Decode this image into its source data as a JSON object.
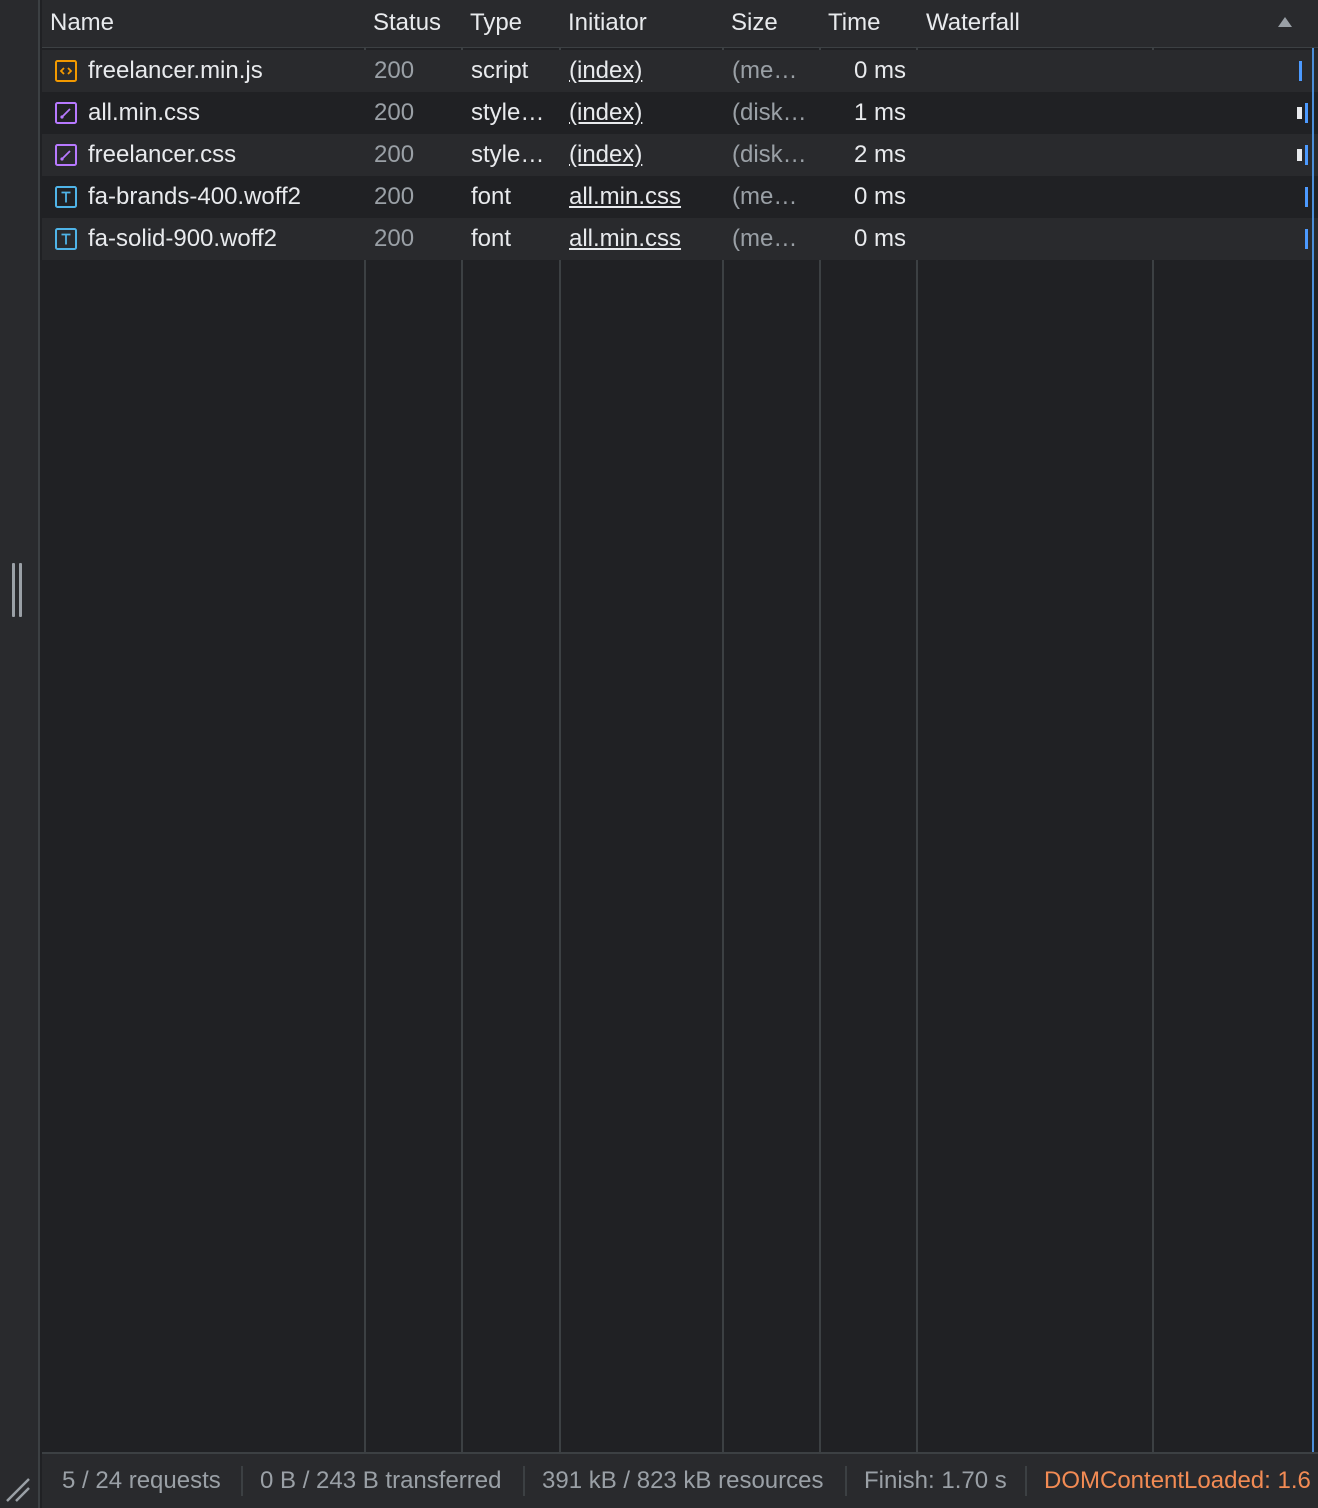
{
  "columns": {
    "name": "Name",
    "status": "Status",
    "type": "Type",
    "initiator": "Initiator",
    "size": "Size",
    "time": "Time",
    "waterfall": "Waterfall"
  },
  "rows": [
    {
      "name": "freelancer.min.js",
      "icon": "script-icon",
      "status": "200",
      "type": "script",
      "initiator": "(index)",
      "size": "(me…",
      "time": "0 ms"
    },
    {
      "name": "all.min.css",
      "icon": "stylesheet-icon",
      "status": "200",
      "type": "style…",
      "initiator": "(index)",
      "size": "(disk…",
      "time": "1 ms"
    },
    {
      "name": "freelancer.css",
      "icon": "stylesheet-icon",
      "status": "200",
      "type": "style…",
      "initiator": "(index)",
      "size": "(disk…",
      "time": "2 ms"
    },
    {
      "name": "fa-brands-400.woff2",
      "icon": "font-icon",
      "status": "200",
      "type": "font",
      "initiator": "all.min.css",
      "size": "(me…",
      "time": "0 ms"
    },
    {
      "name": "fa-solid-900.woff2",
      "icon": "font-icon",
      "status": "200",
      "type": "font",
      "initiator": "all.min.css",
      "size": "(me…",
      "time": "0 ms"
    }
  ],
  "statusbar": {
    "requests": "5 / 24 requests",
    "transferred": "0 B / 243 B transferred",
    "resources": "391 kB / 823 kB resources",
    "finish": "Finish: 1.70 s",
    "dom_content_loaded": "DOMContentLoaded: 1.6"
  },
  "colors": {
    "background": "#202124",
    "row_alt": "#292a2d",
    "script_icon": "#f29900",
    "stylesheet_icon": "#b779ff",
    "font_icon": "#4fb4e8",
    "waterfall_bar": "#4c9aff",
    "dom_content_loaded": "#f28b54"
  }
}
